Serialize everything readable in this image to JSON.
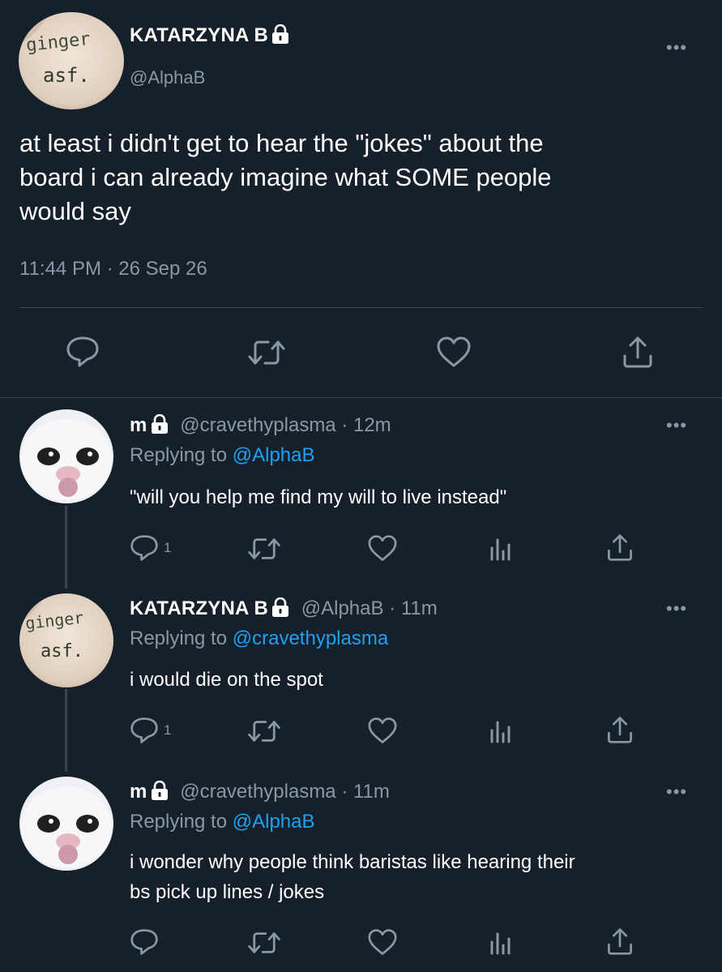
{
  "main_tweet": {
    "display_name": "KATARZYNA B",
    "handle": "@AlphaB",
    "avatar_text_1": "ginger",
    "avatar_text_2": "asf.",
    "text_line_1": "at least i didn't get to hear the \"jokes\" about the",
    "text_line_2": "board i can already imagine what SOME people",
    "text_line_3": "would say",
    "timestamp": "11:44 PM · 26 Sep 26",
    "more_label": "•••"
  },
  "replies": [
    {
      "display_name": "m",
      "handle_time": "@cravethyplasma · 12m",
      "replying_prefix": "Replying to ",
      "replying_to": "@AlphaB",
      "text_line_1": "\"will you help me find my will to live instead\"",
      "text_line_2": "",
      "reply_count": "1",
      "more_label": "•••"
    },
    {
      "display_name": "KATARZYNA B",
      "handle_time": "@AlphaB · 11m",
      "replying_prefix": "Replying to ",
      "replying_to": "@cravethyplasma",
      "text_line_1": "i would die on the spot",
      "text_line_2": "",
      "reply_count": "1",
      "avatar_text_1": "ginger",
      "avatar_text_2": "asf.",
      "more_label": "•••"
    },
    {
      "display_name": "m",
      "handle_time": "@cravethyplasma · 11m",
      "replying_prefix": "Replying to ",
      "replying_to": "@AlphaB",
      "text_line_1": "i wonder why people think baristas like hearing their",
      "text_line_2": "bs pick up lines / jokes",
      "reply_count": "",
      "more_label": "•••"
    }
  ],
  "colors": {
    "background": "#15202b",
    "muted": "#8899a6",
    "link": "#1da1f2",
    "divider": "#38444d",
    "text": "#ffffff"
  },
  "icons": [
    "reply-icon",
    "retweet-icon",
    "like-icon",
    "analytics-icon",
    "share-icon",
    "lock-icon",
    "more-icon"
  ]
}
